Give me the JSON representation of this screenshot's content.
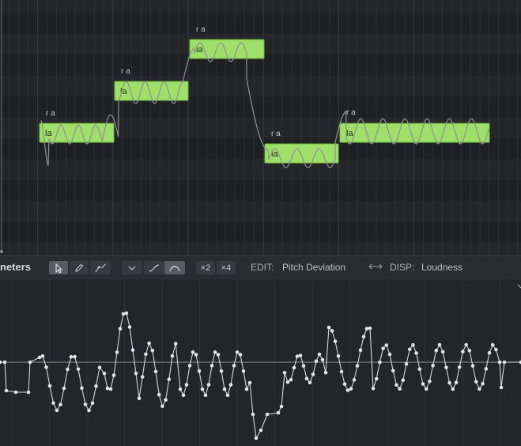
{
  "roll": {
    "notes": [
      {
        "lyric": "la",
        "phoneme": "r a"
      },
      {
        "lyric": "la",
        "phoneme": "r a"
      },
      {
        "lyric": "la",
        "phoneme": "r a"
      },
      {
        "lyric": "la",
        "phoneme": "r a"
      },
      {
        "lyric": "la",
        "phoneme": "r a"
      }
    ]
  },
  "toolbar": {
    "panel_title": "neters",
    "edit_label": "EDIT:",
    "edit_value": "Pitch Deviation",
    "disp_label": "DISP:",
    "disp_value": "Loudness",
    "x2_label": "×2",
    "x4_label": "×4",
    "active_tool": "select-tool",
    "active_curve_tool": "curve-smooth-tool"
  },
  "colors": {
    "note_fill": "#9fe06a",
    "note_border": "#6fb83c",
    "pitch_curve": "#8f9094",
    "param_curve": "#d6d6d6",
    "background": "#222326"
  }
}
